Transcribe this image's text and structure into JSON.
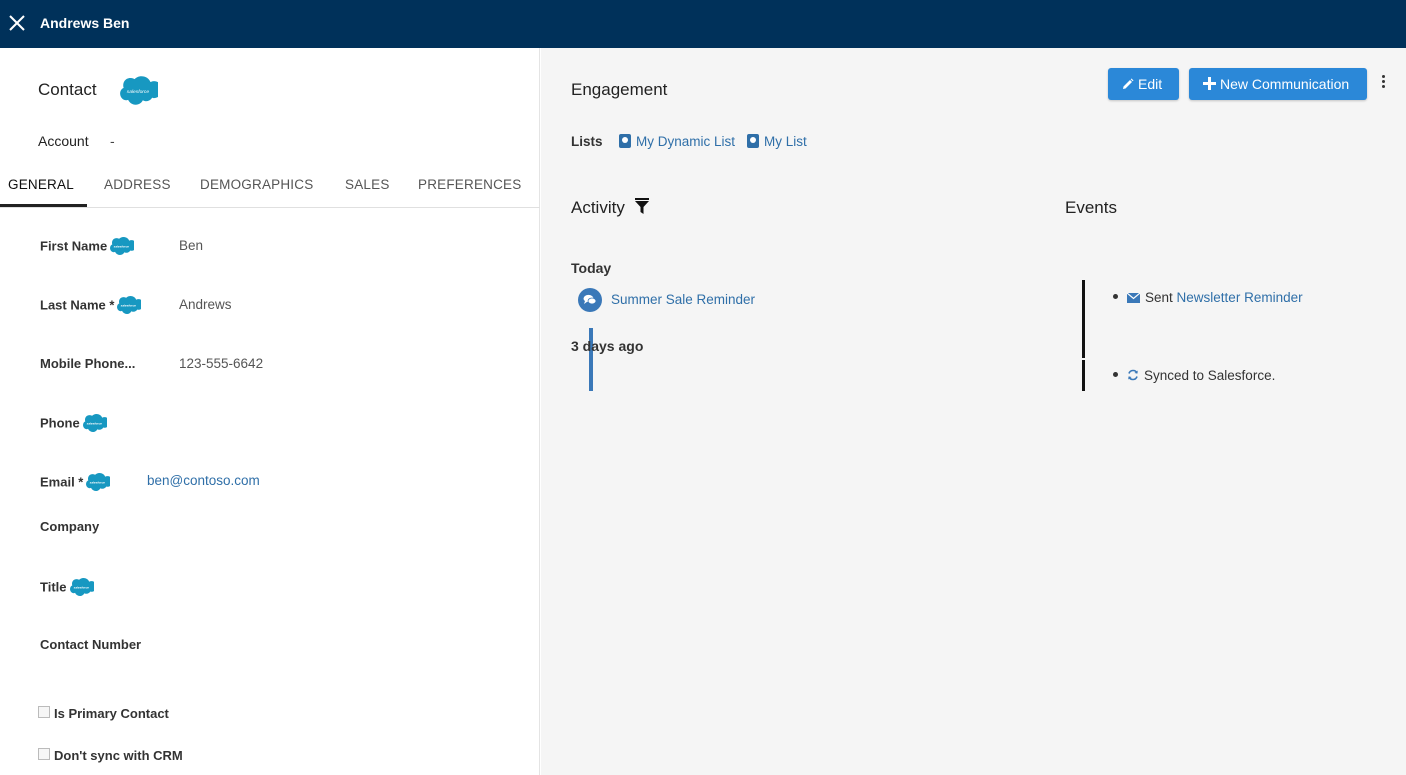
{
  "header": {
    "title": "Andrews Ben"
  },
  "contact": {
    "heading": "Contact",
    "account_label": "Account",
    "account_value": "-"
  },
  "tabs": [
    {
      "label": "GENERAL",
      "active": true
    },
    {
      "label": "ADDRESS",
      "active": false
    },
    {
      "label": "DEMOGRAPHICS",
      "active": false
    },
    {
      "label": "SALES",
      "active": false
    },
    {
      "label": "PREFERENCES",
      "active": false
    }
  ],
  "fields": {
    "first_name": {
      "label": "First Name",
      "value": "Ben"
    },
    "last_name": {
      "label": "Last Name *",
      "value": "Andrews"
    },
    "mobile_phone": {
      "label": "Mobile Phone...",
      "value": "123-555-6642"
    },
    "phone": {
      "label": "Phone",
      "value": ""
    },
    "email": {
      "label": "Email *",
      "value": "ben@contoso.com"
    },
    "company": {
      "label": "Company",
      "value": ""
    },
    "title": {
      "label": "Title",
      "value": ""
    },
    "contact_number": {
      "label": "Contact Number",
      "value": ""
    }
  },
  "checkboxes": {
    "is_primary": {
      "label": "Is Primary Contact",
      "checked": false
    },
    "dont_sync": {
      "label": "Don't sync with CRM",
      "checked": false
    }
  },
  "engagement": {
    "heading": "Engagement",
    "edit_label": "Edit",
    "new_comm_label": "New Communication",
    "lists_label": "Lists",
    "lists": [
      "My Dynamic List",
      "My List"
    ]
  },
  "activity": {
    "heading": "Activity",
    "groups": [
      {
        "label": "Today",
        "items": [
          "Summer Sale Reminder"
        ]
      },
      {
        "label": "3 days ago",
        "items": []
      }
    ]
  },
  "events": {
    "heading": "Events",
    "items": [
      {
        "prefix": "Sent",
        "link": "Newsletter Reminder",
        "icon": "envelope-icon"
      },
      {
        "prefix": "Synced to Salesforce.",
        "link": "",
        "icon": "sync-icon"
      }
    ]
  },
  "colors": {
    "topbar": "#00315a",
    "accent_button": "#2b88d8",
    "link": "#2f6fa8",
    "salesforce": "#1798c1"
  }
}
